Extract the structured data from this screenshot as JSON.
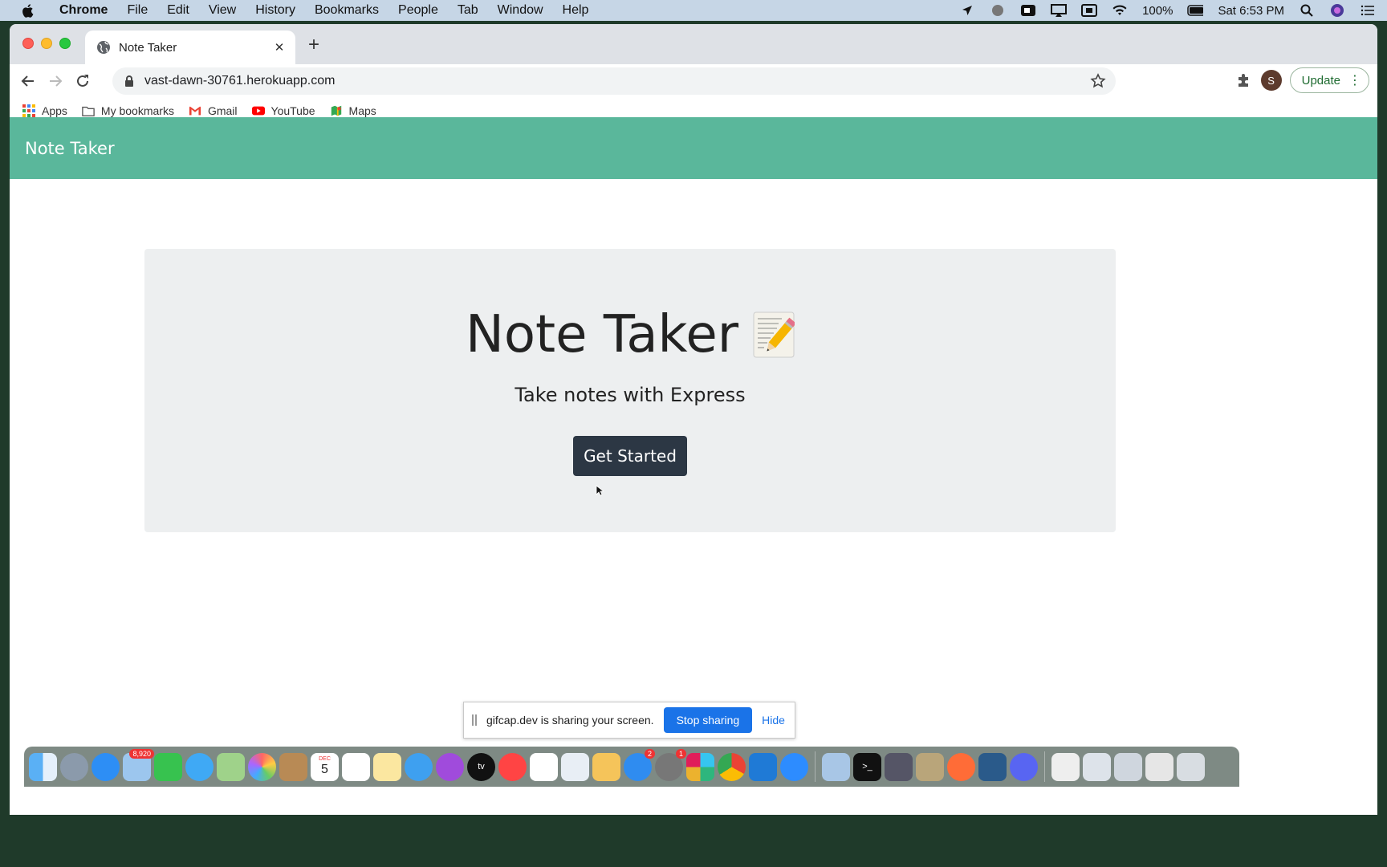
{
  "menubar": {
    "app_name": "Chrome",
    "items": [
      "File",
      "Edit",
      "View",
      "History",
      "Bookmarks",
      "People",
      "Tab",
      "Window",
      "Help"
    ],
    "battery": "100%",
    "clock": "Sat 6:53 PM"
  },
  "browser": {
    "tab_title": "Note Taker",
    "url": "vast-dawn-30761.herokuapp.com",
    "avatar_initial": "S",
    "update_label": "Update",
    "bookmarks": [
      "Apps",
      "My bookmarks",
      "Gmail",
      "YouTube",
      "Maps"
    ]
  },
  "page": {
    "brand": "Note Taker",
    "heading": "Note Taker",
    "subheading": "Take notes with Express",
    "cta_label": "Get Started",
    "colors": {
      "navbar": "#5ab79b",
      "button": "#2c3744",
      "jumbotron": "#edeff0"
    }
  },
  "share_bar": {
    "message": "gifcap.dev is sharing your screen.",
    "stop_label": "Stop sharing",
    "hide_label": "Hide"
  },
  "dock": {
    "badges": {
      "mail": "8,920",
      "calendar_day": "5",
      "calendar_month": "DEC",
      "appstore": "2",
      "settings": "1"
    }
  }
}
